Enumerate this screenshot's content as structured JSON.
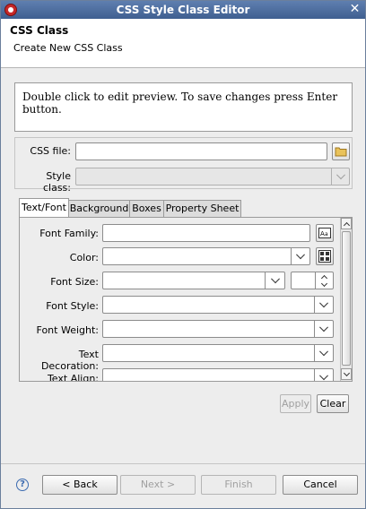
{
  "window": {
    "title": "CSS Style Class Editor"
  },
  "header": {
    "title": "CSS Class",
    "subtitle": "Create New CSS Class"
  },
  "preview": {
    "text": "Double click to edit preview. To save changes press Enter button."
  },
  "form": {
    "css_file_label": "CSS file:",
    "css_file_value": "",
    "style_class_label": "Style class:",
    "style_class_value": ""
  },
  "tabs": [
    {
      "label": "Text/Font",
      "active": true
    },
    {
      "label": "Background",
      "active": false
    },
    {
      "label": "Boxes",
      "active": false
    },
    {
      "label": "Property Sheet",
      "active": false
    }
  ],
  "text_font": {
    "font_family_label": "Font Family:",
    "color_label": "Color:",
    "font_size_label": "Font Size:",
    "font_style_label": "Font Style:",
    "font_weight_label": "Font Weight:",
    "text_decoration_label": "Text Decoration:",
    "text_align_label": "Text Align:"
  },
  "actions": {
    "apply_label": "Apply",
    "clear_label": "Clear"
  },
  "footer": {
    "back_label": "< Back",
    "next_label": "Next >",
    "finish_label": "Finish",
    "cancel_label": "Cancel"
  },
  "icons": {
    "app": "eclipse-icon",
    "close": "close-icon",
    "browse": "folder-icon",
    "font_chooser": "font-chooser-icon",
    "color_picker": "color-palette-icon",
    "help": "help-icon"
  },
  "colors": {
    "title_bar": "#4a6a9c",
    "folder": "#e0b040"
  }
}
